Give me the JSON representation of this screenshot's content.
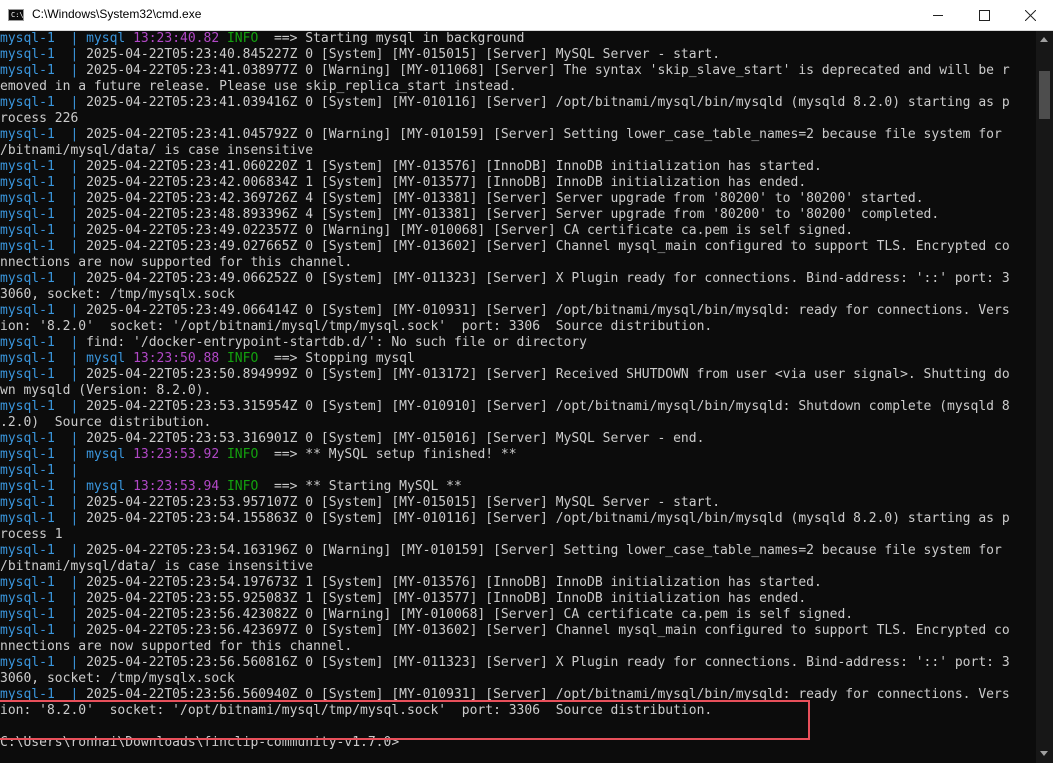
{
  "window": {
    "title": "C:\\Windows\\System32\\cmd.exe",
    "icon_text": "C:\\"
  },
  "colors": {
    "background": "#0c0c0c",
    "text": "#cccccc",
    "container_prefix": "#3a96dd",
    "log_time": "#b148c6",
    "log_level": "#13a10e",
    "highlight_box": "#e8505b"
  },
  "console": {
    "lines": [
      {
        "type": "tagged",
        "prefix": "mysql-1  | ",
        "name": "mysql",
        "time": "13:23:40.82",
        "level": "INFO",
        "msg": "  ==> Starting mysql in background"
      },
      {
        "type": "log",
        "prefix": "mysql-1  | ",
        "text": "2025-04-22T05:23:40.845227Z 0 [System] [MY-015015] [Server] MySQL Server - start."
      },
      {
        "type": "log",
        "prefix": "mysql-1  | ",
        "text": "2025-04-22T05:23:41.038977Z 0 [Warning] [MY-011068] [Server] The syntax 'skip_slave_start' is deprecated and will be r"
      },
      {
        "type": "plain",
        "text": "emoved in a future release. Please use skip_replica_start instead."
      },
      {
        "type": "log",
        "prefix": "mysql-1  | ",
        "text": "2025-04-22T05:23:41.039416Z 0 [System] [MY-010116] [Server] /opt/bitnami/mysql/bin/mysqld (mysqld 8.2.0) starting as p"
      },
      {
        "type": "plain",
        "text": "rocess 226"
      },
      {
        "type": "log",
        "prefix": "mysql-1  | ",
        "text": "2025-04-22T05:23:41.045792Z 0 [Warning] [MY-010159] [Server] Setting lower_case_table_names=2 because file system for"
      },
      {
        "type": "plain",
        "text": "/bitnami/mysql/data/ is case insensitive"
      },
      {
        "type": "log",
        "prefix": "mysql-1  | ",
        "text": "2025-04-22T05:23:41.060220Z 1 [System] [MY-013576] [InnoDB] InnoDB initialization has started."
      },
      {
        "type": "log",
        "prefix": "mysql-1  | ",
        "text": "2025-04-22T05:23:42.006834Z 1 [System] [MY-013577] [InnoDB] InnoDB initialization has ended."
      },
      {
        "type": "log",
        "prefix": "mysql-1  | ",
        "text": "2025-04-22T05:23:42.369726Z 4 [System] [MY-013381] [Server] Server upgrade from '80200' to '80200' started."
      },
      {
        "type": "log",
        "prefix": "mysql-1  | ",
        "text": "2025-04-22T05:23:48.893396Z 4 [System] [MY-013381] [Server] Server upgrade from '80200' to '80200' completed."
      },
      {
        "type": "log",
        "prefix": "mysql-1  | ",
        "text": "2025-04-22T05:23:49.022357Z 0 [Warning] [MY-010068] [Server] CA certificate ca.pem is self signed."
      },
      {
        "type": "log",
        "prefix": "mysql-1  | ",
        "text": "2025-04-22T05:23:49.027665Z 0 [System] [MY-013602] [Server] Channel mysql_main configured to support TLS. Encrypted co"
      },
      {
        "type": "plain",
        "text": "nnections are now supported for this channel."
      },
      {
        "type": "log",
        "prefix": "mysql-1  | ",
        "text": "2025-04-22T05:23:49.066252Z 0 [System] [MY-011323] [Server] X Plugin ready for connections. Bind-address: '::' port: 3"
      },
      {
        "type": "plain",
        "text": "3060, socket: /tmp/mysqlx.sock"
      },
      {
        "type": "log",
        "prefix": "mysql-1  | ",
        "text": "2025-04-22T05:23:49.066414Z 0 [System] [MY-010931] [Server] /opt/bitnami/mysql/bin/mysqld: ready for connections. Vers"
      },
      {
        "type": "plain",
        "text": "ion: '8.2.0'  socket: '/opt/bitnami/mysql/tmp/mysql.sock'  port: 3306  Source distribution."
      },
      {
        "type": "log",
        "prefix": "mysql-1  | ",
        "text": "find: '/docker-entrypoint-startdb.d/': No such file or directory"
      },
      {
        "type": "tagged",
        "prefix": "mysql-1  | ",
        "name": "mysql",
        "time": "13:23:50.88",
        "level": "INFO",
        "msg": "  ==> Stopping mysql"
      },
      {
        "type": "log",
        "prefix": "mysql-1  | ",
        "text": "2025-04-22T05:23:50.894999Z 0 [System] [MY-013172] [Server] Received SHUTDOWN from user <via user signal>. Shutting do"
      },
      {
        "type": "plain",
        "text": "wn mysqld (Version: 8.2.0)."
      },
      {
        "type": "log",
        "prefix": "mysql-1  | ",
        "text": "2025-04-22T05:23:53.315954Z 0 [System] [MY-010910] [Server] /opt/bitnami/mysql/bin/mysqld: Shutdown complete (mysqld 8"
      },
      {
        "type": "plain",
        "text": ".2.0)  Source distribution."
      },
      {
        "type": "log",
        "prefix": "mysql-1  | ",
        "text": "2025-04-22T05:23:53.316901Z 0 [System] [MY-015016] [Server] MySQL Server - end."
      },
      {
        "type": "tagged",
        "prefix": "mysql-1  | ",
        "name": "mysql",
        "time": "13:23:53.92",
        "level": "INFO",
        "msg": "  ==> ** MySQL setup finished! **"
      },
      {
        "type": "log",
        "prefix": "mysql-1  | ",
        "text": ""
      },
      {
        "type": "tagged",
        "prefix": "mysql-1  | ",
        "name": "mysql",
        "time": "13:23:53.94",
        "level": "INFO",
        "msg": "  ==> ** Starting MySQL **"
      },
      {
        "type": "log",
        "prefix": "mysql-1  | ",
        "text": "2025-04-22T05:23:53.957107Z 0 [System] [MY-015015] [Server] MySQL Server - start."
      },
      {
        "type": "log",
        "prefix": "mysql-1  | ",
        "text": "2025-04-22T05:23:54.155863Z 0 [System] [MY-010116] [Server] /opt/bitnami/mysql/bin/mysqld (mysqld 8.2.0) starting as p"
      },
      {
        "type": "plain",
        "text": "rocess 1"
      },
      {
        "type": "log",
        "prefix": "mysql-1  | ",
        "text": "2025-04-22T05:23:54.163196Z 0 [Warning] [MY-010159] [Server] Setting lower_case_table_names=2 because file system for"
      },
      {
        "type": "plain",
        "text": "/bitnami/mysql/data/ is case insensitive"
      },
      {
        "type": "log",
        "prefix": "mysql-1  | ",
        "text": "2025-04-22T05:23:54.197673Z 1 [System] [MY-013576] [InnoDB] InnoDB initialization has started."
      },
      {
        "type": "log",
        "prefix": "mysql-1  | ",
        "text": "2025-04-22T05:23:55.925083Z 1 [System] [MY-013577] [InnoDB] InnoDB initialization has ended."
      },
      {
        "type": "log",
        "prefix": "mysql-1  | ",
        "text": "2025-04-22T05:23:56.423082Z 0 [Warning] [MY-010068] [Server] CA certificate ca.pem is self signed."
      },
      {
        "type": "log",
        "prefix": "mysql-1  | ",
        "text": "2025-04-22T05:23:56.423697Z 0 [System] [MY-013602] [Server] Channel mysql_main configured to support TLS. Encrypted co"
      },
      {
        "type": "plain",
        "text": "nnections are now supported for this channel."
      },
      {
        "type": "log",
        "prefix": "mysql-1  | ",
        "text": "2025-04-22T05:23:56.560816Z 0 [System] [MY-011323] [Server] X Plugin ready for connections. Bind-address: '::' port: 3"
      },
      {
        "type": "plain",
        "text": "3060, socket: /tmp/mysqlx.sock"
      },
      {
        "type": "log",
        "prefix": "mysql-1  | ",
        "text": "2025-04-22T05:23:56.560940Z 0 [System] [MY-010931] [Server] /opt/bitnami/mysql/bin/mysqld: ready for connections. Vers"
      },
      {
        "type": "plain",
        "text": "ion: '8.2.0'  socket: '/opt/bitnami/mysql/tmp/mysql.sock'  port: 3306  Source distribution."
      },
      {
        "type": "plain",
        "text": ""
      },
      {
        "type": "plain",
        "text": "C:\\Users\\ronhai\\Downloads\\finclip-community-v1.7.0>"
      }
    ]
  }
}
